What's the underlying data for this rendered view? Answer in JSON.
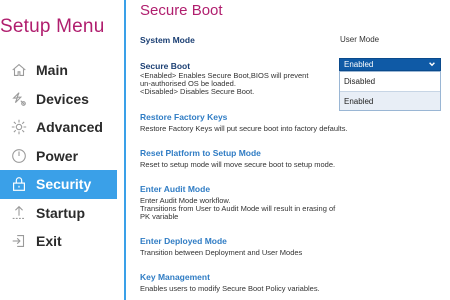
{
  "sidebar": {
    "title": "Setup Menu",
    "items": [
      {
        "label": "Main",
        "icon": "home-icon"
      },
      {
        "label": "Devices",
        "icon": "devices-icon"
      },
      {
        "label": "Advanced",
        "icon": "advanced-icon"
      },
      {
        "label": "Power",
        "icon": "power-icon"
      },
      {
        "label": "Security",
        "icon": "security-icon",
        "active": true
      },
      {
        "label": "Startup",
        "icon": "startup-icon"
      },
      {
        "label": "Exit",
        "icon": "exit-icon"
      }
    ]
  },
  "main": {
    "title": "Secure Boot",
    "system_mode": {
      "label": "System Mode",
      "value": "User Mode"
    },
    "secure_boot": {
      "label": "Secure Boot",
      "desc1": "<Enabled> Enables Secure Boot,BIOS will prevent",
      "desc2": "un-authorised OS be loaded.",
      "desc3": "<Disabled> Disables Secure Boot.",
      "selected": "Enabled",
      "options": [
        "Disabled",
        "Enabled"
      ]
    },
    "restore_keys": {
      "title": "Restore Factory Keys",
      "desc": "Restore Factory Keys will put secure boot into factory defaults."
    },
    "reset_platform": {
      "title": "Reset Platform to Setup Mode",
      "desc": "Reset to setup mode will move secure boot to setup mode."
    },
    "audit_mode": {
      "title": "Enter Audit Mode",
      "desc1": "Enter Audit Mode workflow.",
      "desc2": "Transitions from User to Audit Mode will result in erasing of",
      "desc3": "PK variable"
    },
    "deployed_mode": {
      "title": "Enter Deployed Mode",
      "desc": "Transition between Deployment and User Modes"
    },
    "key_management": {
      "title": "Key Management",
      "desc": "Enables users to modify Secure Boot Policy variables."
    }
  },
  "colors": {
    "accent": "#3aa0e8",
    "title": "#b01e6e",
    "select": "#0f5aa6",
    "section": "#2f7cc4"
  }
}
